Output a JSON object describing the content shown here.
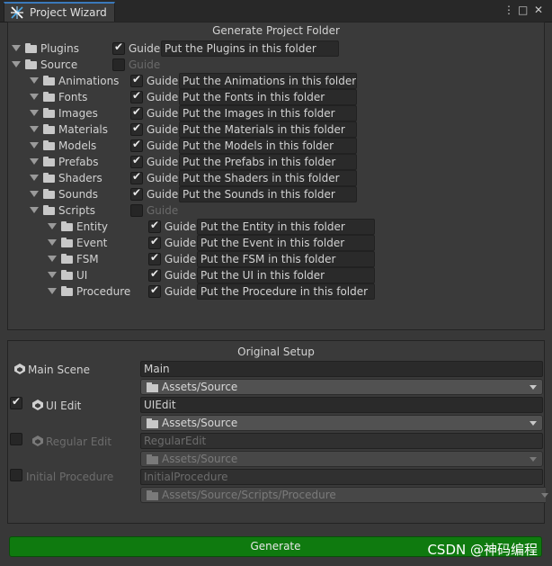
{
  "window": {
    "tab_title": "Project Wizard",
    "controls": [
      "⋮",
      "□",
      "✕"
    ]
  },
  "generate_section": {
    "title": "Generate Project Folder",
    "guide_label": "Guide",
    "rows": [
      {
        "name": "Plugins",
        "level": 0,
        "guide_checked": true,
        "guide_enabled": true,
        "text": "Put the Plugins in this folder"
      },
      {
        "name": "Source",
        "level": 0,
        "guide_checked": false,
        "guide_enabled": false,
        "text": ""
      },
      {
        "name": "Animations",
        "level": 1,
        "guide_checked": true,
        "guide_enabled": true,
        "text": "Put the Animations in this folder"
      },
      {
        "name": "Fonts",
        "level": 1,
        "guide_checked": true,
        "guide_enabled": true,
        "text": "Put the Fonts in this folder"
      },
      {
        "name": "Images",
        "level": 1,
        "guide_checked": true,
        "guide_enabled": true,
        "text": "Put the Images in this folder"
      },
      {
        "name": "Materials",
        "level": 1,
        "guide_checked": true,
        "guide_enabled": true,
        "text": "Put the Materials in this folder"
      },
      {
        "name": "Models",
        "level": 1,
        "guide_checked": true,
        "guide_enabled": true,
        "text": "Put the Models in this folder"
      },
      {
        "name": "Prefabs",
        "level": 1,
        "guide_checked": true,
        "guide_enabled": true,
        "text": "Put the Prefabs in this folder"
      },
      {
        "name": "Shaders",
        "level": 1,
        "guide_checked": true,
        "guide_enabled": true,
        "text": "Put the Shaders in this folder"
      },
      {
        "name": "Sounds",
        "level": 1,
        "guide_checked": true,
        "guide_enabled": true,
        "text": "Put the Sounds in this folder"
      },
      {
        "name": "Scripts",
        "level": 1,
        "guide_checked": false,
        "guide_enabled": false,
        "text": ""
      },
      {
        "name": "Entity",
        "level": 2,
        "guide_checked": true,
        "guide_enabled": true,
        "text": "Put the Entity in this folder"
      },
      {
        "name": "Event",
        "level": 2,
        "guide_checked": true,
        "guide_enabled": true,
        "text": "Put the Event in this folder"
      },
      {
        "name": "FSM",
        "level": 2,
        "guide_checked": true,
        "guide_enabled": true,
        "text": "Put the FSM in this folder"
      },
      {
        "name": "UI",
        "level": 2,
        "guide_checked": true,
        "guide_enabled": true,
        "text": "Put the UI in this folder"
      },
      {
        "name": "Procedure",
        "level": 2,
        "guide_checked": true,
        "guide_enabled": true,
        "text": "Put the Procedure in this folder"
      }
    ]
  },
  "setup_section": {
    "title": "Original Setup",
    "main_scene": {
      "label": "Main Scene",
      "value": "Main",
      "path": "Assets/Source"
    },
    "ui_edit": {
      "label": "UI Edit",
      "checked": true,
      "value": "UIEdit",
      "path": "Assets/Source"
    },
    "regular_edit": {
      "label": "Regular Edit",
      "checked": false,
      "value": "RegularEdit",
      "path": "Assets/Source"
    },
    "initial_procedure": {
      "label": "Initial Procedure",
      "checked": false,
      "value": "InitialProcedure",
      "path": "Assets/Source/Scripts/Procedure"
    }
  },
  "generate_button": {
    "label": "Generate"
  },
  "watermark": "CSDN @神码编程",
  "colors": {
    "accent": "#3a79bb",
    "generate": "#0f7a0f",
    "panel": "#3a3a3a"
  }
}
